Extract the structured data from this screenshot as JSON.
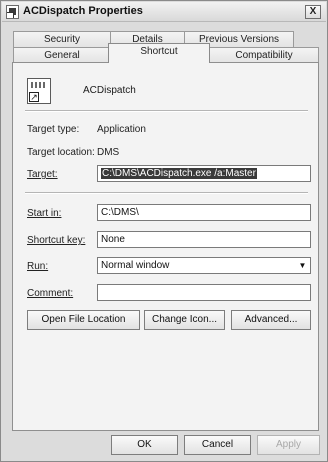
{
  "window": {
    "title": "ACDispatch Properties",
    "close_glyph": "X"
  },
  "tabs_row1": [
    {
      "label": "Security"
    },
    {
      "label": "Details"
    },
    {
      "label": "Previous Versions"
    }
  ],
  "tabs_row2": [
    {
      "label": "General"
    },
    {
      "label": "Shortcut",
      "active": true
    },
    {
      "label": "Compatibility"
    }
  ],
  "shortcut": {
    "icon": "shortcut-app-icon",
    "name": "ACDispatch",
    "target_type_label": "Target type:",
    "target_type": "Application",
    "target_location_label": "Target location:",
    "target_location": "DMS",
    "target_label": "Target:",
    "target_value": "C:\\DMS\\ACDispatch.exe /a:Master",
    "start_in_label": "Start in:",
    "start_in_value": "C:\\DMS\\",
    "shortcut_key_label": "Shortcut key:",
    "shortcut_key_value": "None",
    "run_label": "Run:",
    "run_value": "Normal window",
    "comment_label": "Comment:",
    "comment_value": ""
  },
  "buttons": {
    "open_file_location": "Open File Location",
    "change_icon": "Change Icon...",
    "advanced": "Advanced...",
    "ok": "OK",
    "cancel": "Cancel",
    "apply": "Apply"
  }
}
